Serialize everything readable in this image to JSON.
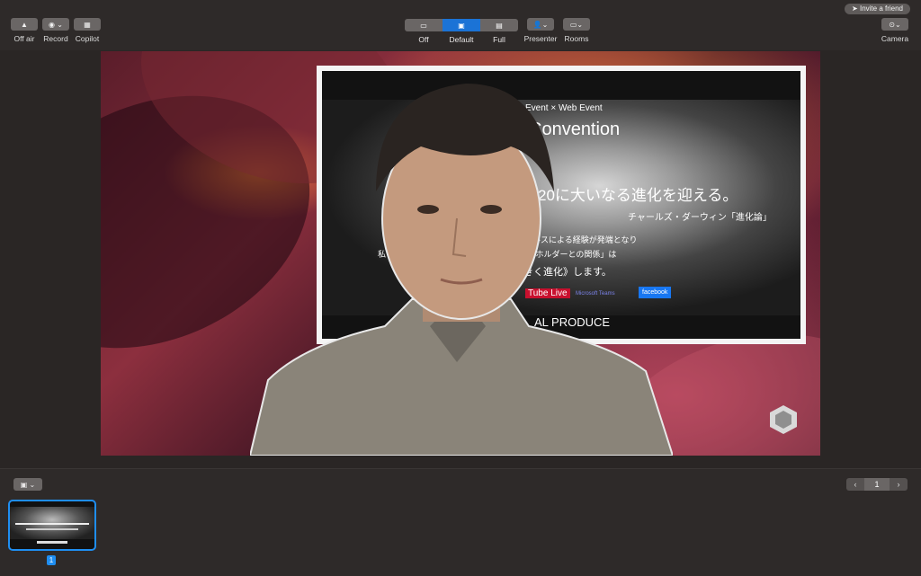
{
  "toolbar": {
    "left": [
      {
        "id": "off-air",
        "label": "Off air",
        "icon": "antenna-icon"
      },
      {
        "id": "record",
        "label": "Record",
        "icon": "record-icon"
      },
      {
        "id": "copilot",
        "label": "Copilot",
        "icon": "copilot-icon"
      }
    ],
    "layouts": [
      {
        "id": "off",
        "label": "Off",
        "active": false
      },
      {
        "id": "default",
        "label": "Default",
        "active": true
      },
      {
        "id": "full",
        "label": "Full",
        "active": false
      }
    ],
    "presenter_label": "Presenter",
    "rooms_label": "Rooms",
    "camera_label": "Camera",
    "invite_label": "Invite a friend"
  },
  "slide": {
    "line1": "Event × Web Event",
    "line2": "Convention",
    "line3": "20に大いなる進化を迎える。",
    "line4": "チャールズ・ダーウィン「進化論」",
    "line5": "ルスによる経験が発端となり",
    "line6": "私　　　　　　社と社員の関係」「ステークホルダーとの関係」は",
    "line7": "きく進化》します。",
    "logo_youtube": "Tube Live",
    "logo_teams": "Microsoft Teams",
    "logo_facebook": "facebook",
    "footer": "AL PRODUCE"
  },
  "thumbnails": {
    "page": "1",
    "items": [
      {
        "number": "1"
      }
    ]
  },
  "colors": {
    "accent": "#1b73d6",
    "thumb_border": "#1f8ef1",
    "bar_bg": "#2e2a29"
  }
}
